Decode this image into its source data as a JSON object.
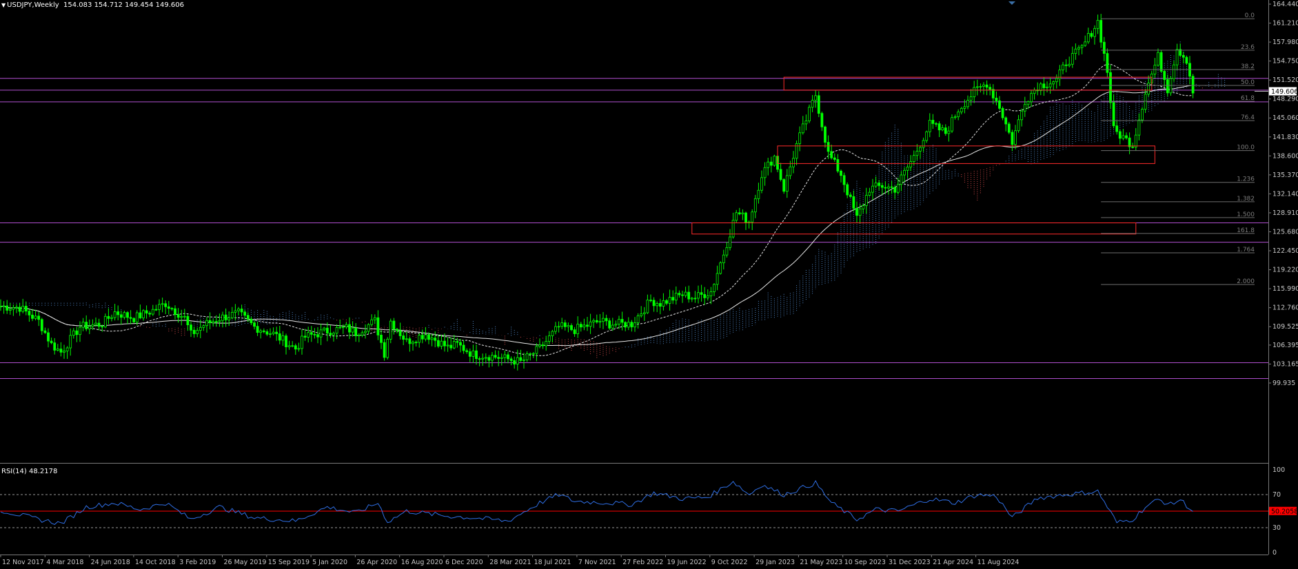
{
  "header": {
    "symbol": "USDJPY,Weekly",
    "ohlc": "154.083 154.712 149.454 149.606"
  },
  "rsi_header": "RSI(14) 48.2178",
  "price_axis": [
    "164.440",
    "161.210",
    "157.980",
    "154.750",
    "151.520",
    "148.290",
    "145.060",
    "141.830",
    "138.600",
    "135.370",
    "132.140",
    "128.910",
    "125.680",
    "122.450",
    "119.220",
    "115.990",
    "112.760",
    "109.525",
    "106.395",
    "103.165",
    "99.935"
  ],
  "rsi_axis": [
    "100",
    "70",
    "50",
    "30",
    "0"
  ],
  "current_price": "149.606",
  "current_rsi": "50.2058",
  "date_axis": [
    "12 Nov 2017",
    "4 Mar 2018",
    "24 Jun 2018",
    "14 Oct 2018",
    "3 Feb 2019",
    "26 May 2019",
    "15 Sep 2019",
    "5 Jan 2020",
    "26 Apr 2020",
    "16 Aug 2020",
    "6 Dec 2020",
    "28 Mar 2021",
    "18 Jul 2021",
    "7 Nov 2021",
    "27 Feb 2022",
    "19 Jun 2022",
    "9 Oct 2022",
    "29 Jan 2023",
    "21 May 2023",
    "10 Sep 2023",
    "31 Dec 2023",
    "21 Apr 2024",
    "11 Aug 2024"
  ],
  "fib_levels": [
    {
      "label": "0.0",
      "price": 161.95
    },
    {
      "label": "23.6",
      "price": 156.6
    },
    {
      "label": "38.2",
      "price": 153.3
    },
    {
      "label": "50.0",
      "price": 150.6
    },
    {
      "label": "61.8",
      "price": 147.9
    },
    {
      "label": "76.4",
      "price": 144.6
    },
    {
      "label": "100.0",
      "price": 139.5
    },
    {
      "label": "1.236",
      "price": 134.1
    },
    {
      "label": "1.382",
      "price": 130.8
    },
    {
      "label": "1.500",
      "price": 128.1
    },
    {
      "label": "161.8",
      "price": 125.4
    },
    {
      "label": "1.764",
      "price": 122.1
    },
    {
      "label": "2.000",
      "price": 116.7
    }
  ],
  "horizontal_lines": [
    151.8,
    149.8,
    147.8,
    127.2,
    123.9,
    103.4,
    100.7
  ],
  "zones": [
    {
      "p1": 152.0,
      "p2": 149.8,
      "w1": "2022-08-07",
      "w2": "2024-10-27"
    },
    {
      "p1": 140.3,
      "p2": 137.3,
      "w1": "2022-07-24",
      "w2": "2024-11-03"
    },
    {
      "p1": 127.2,
      "p2": 125.3,
      "w1": "2022-01-16",
      "w2": "2024-09-22"
    }
  ],
  "colors": {
    "candle": "#00ff00",
    "cloud_blue": "#4f86c6",
    "cloud_red": "#d24a4a",
    "sma": "#e8e8e8",
    "hline": "#b04fcf",
    "zone": "#ff2a2a",
    "rsi": "#2f6fe6",
    "rsi_mid": "#ff0000"
  },
  "price_path": [
    [
      "2017-11-12",
      113.0
    ],
    [
      "2017-12-24",
      112.8
    ],
    [
      "2018-02-04",
      110.5
    ],
    [
      "2018-03-04",
      106.5
    ],
    [
      "2018-03-25",
      105.2
    ],
    [
      "2018-05-06",
      109.5
    ],
    [
      "2018-06-24",
      110.0
    ],
    [
      "2018-07-22",
      112.0
    ],
    [
      "2018-09-02",
      111.0
    ],
    [
      "2018-10-14",
      112.3
    ],
    [
      "2018-11-11",
      113.5
    ],
    [
      "2018-12-23",
      111.0
    ],
    [
      "2019-01-06",
      108.2
    ],
    [
      "2019-02-03",
      109.8
    ],
    [
      "2019-03-10",
      111.0
    ],
    [
      "2019-04-21",
      111.8
    ],
    [
      "2019-05-26",
      109.5
    ],
    [
      "2019-07-07",
      108.3
    ],
    [
      "2019-08-25",
      105.8
    ],
    [
      "2019-09-15",
      107.8
    ],
    [
      "2019-11-03",
      108.8
    ],
    [
      "2019-12-15",
      109.3
    ],
    [
      "2020-01-05",
      108.5
    ],
    [
      "2020-02-16",
      110.5
    ],
    [
      "2020-03-08",
      105.0
    ],
    [
      "2020-03-22",
      110.5
    ],
    [
      "2020-04-26",
      107.0
    ],
    [
      "2020-06-07",
      108.3
    ],
    [
      "2020-07-26",
      106.0
    ],
    [
      "2020-08-16",
      106.5
    ],
    [
      "2020-09-20",
      104.8
    ],
    [
      "2020-11-01",
      104.5
    ],
    [
      "2020-12-06",
      104.0
    ],
    [
      "2021-01-03",
      103.5
    ],
    [
      "2021-02-14",
      105.8
    ],
    [
      "2021-03-28",
      109.5
    ],
    [
      "2021-05-02",
      109.0
    ],
    [
      "2021-06-27",
      110.5
    ],
    [
      "2021-07-18",
      110.0
    ],
    [
      "2021-09-05",
      110.0
    ],
    [
      "2021-10-17",
      114.0
    ],
    [
      "2021-11-07",
      113.5
    ],
    [
      "2021-12-26",
      115.0
    ],
    [
      "2022-01-23",
      114.5
    ],
    [
      "2022-02-27",
      115.5
    ],
    [
      "2022-03-27",
      122.0
    ],
    [
      "2022-04-24",
      129.0
    ],
    [
      "2022-05-22",
      127.5
    ],
    [
      "2022-06-19",
      135.5
    ],
    [
      "2022-07-17",
      138.5
    ],
    [
      "2022-08-07",
      133.0
    ],
    [
      "2022-09-04",
      140.5
    ],
    [
      "2022-10-16",
      149.0
    ],
    [
      "2022-11-13",
      139.0
    ],
    [
      "2022-12-11",
      135.5
    ],
    [
      "2023-01-15",
      128.0
    ],
    [
      "2023-02-12",
      133.0
    ],
    [
      "2023-03-12",
      133.5
    ],
    [
      "2023-04-09",
      133.0
    ],
    [
      "2023-05-21",
      138.5
    ],
    [
      "2023-06-25",
      144.0
    ],
    [
      "2023-07-30",
      142.5
    ],
    [
      "2023-08-27",
      146.5
    ],
    [
      "2023-10-01",
      149.5
    ],
    [
      "2023-10-29",
      151.0
    ],
    [
      "2023-11-26",
      147.0
    ],
    [
      "2023-12-24",
      141.0
    ],
    [
      "2024-01-21",
      148.0
    ],
    [
      "2024-02-18",
      150.5
    ],
    [
      "2024-03-31",
      151.5
    ],
    [
      "2024-04-21",
      154.5
    ],
    [
      "2024-05-26",
      157.0
    ],
    [
      "2024-06-30",
      161.5
    ],
    [
      "2024-07-21",
      153.0
    ],
    [
      "2024-08-04",
      143.0
    ],
    [
      "2024-09-15",
      140.5
    ],
    [
      "2024-10-13",
      149.5
    ],
    [
      "2024-11-10",
      155.5
    ],
    [
      "2024-12-01",
      150.0
    ],
    [
      "2024-12-22",
      157.0
    ],
    [
      "2025-01-12",
      155.0
    ],
    [
      "2025-01-26",
      149.6
    ]
  ],
  "rsi_path": [
    [
      "2017-11-12",
      51
    ],
    [
      "2018-02-04",
      40
    ],
    [
      "2018-03-25",
      35
    ],
    [
      "2018-05-20",
      55
    ],
    [
      "2018-07-22",
      60
    ],
    [
      "2018-09-16",
      52
    ],
    [
      "2018-11-11",
      60
    ],
    [
      "2019-01-06",
      40
    ],
    [
      "2019-03-10",
      55
    ],
    [
      "2019-05-26",
      42
    ],
    [
      "2019-08-25",
      38
    ],
    [
      "2019-11-03",
      55
    ],
    [
      "2020-01-05",
      48
    ],
    [
      "2020-02-23",
      60
    ],
    [
      "2020-03-15",
      37
    ],
    [
      "2020-04-26",
      50
    ],
    [
      "2020-07-26",
      44
    ],
    [
      "2020-09-20",
      42
    ],
    [
      "2020-12-06",
      38
    ],
    [
      "2021-02-14",
      60
    ],
    [
      "2021-03-28",
      70
    ],
    [
      "2021-05-02",
      62
    ],
    [
      "2021-07-18",
      60
    ],
    [
      "2021-09-05",
      58
    ],
    [
      "2021-10-24",
      72
    ],
    [
      "2021-12-26",
      65
    ],
    [
      "2022-02-20",
      67
    ],
    [
      "2022-04-17",
      86
    ],
    [
      "2022-05-22",
      70
    ],
    [
      "2022-06-19",
      82
    ],
    [
      "2022-08-07",
      70
    ],
    [
      "2022-10-16",
      84
    ],
    [
      "2022-11-20",
      60
    ],
    [
      "2023-01-15",
      40
    ],
    [
      "2023-02-26",
      52
    ],
    [
      "2023-04-16",
      50
    ],
    [
      "2023-06-25",
      65
    ],
    [
      "2023-08-20",
      60
    ],
    [
      "2023-10-08",
      70
    ],
    [
      "2023-11-19",
      68
    ],
    [
      "2023-12-24",
      42
    ],
    [
      "2024-02-18",
      66
    ],
    [
      "2024-04-21",
      70
    ],
    [
      "2024-06-30",
      74
    ],
    [
      "2024-07-21",
      55
    ],
    [
      "2024-08-11",
      36
    ],
    [
      "2024-09-15",
      40
    ],
    [
      "2024-10-13",
      55
    ],
    [
      "2024-11-10",
      64
    ],
    [
      "2024-12-08",
      58
    ],
    [
      "2024-12-29",
      64
    ],
    [
      "2025-01-26",
      50
    ]
  ]
}
